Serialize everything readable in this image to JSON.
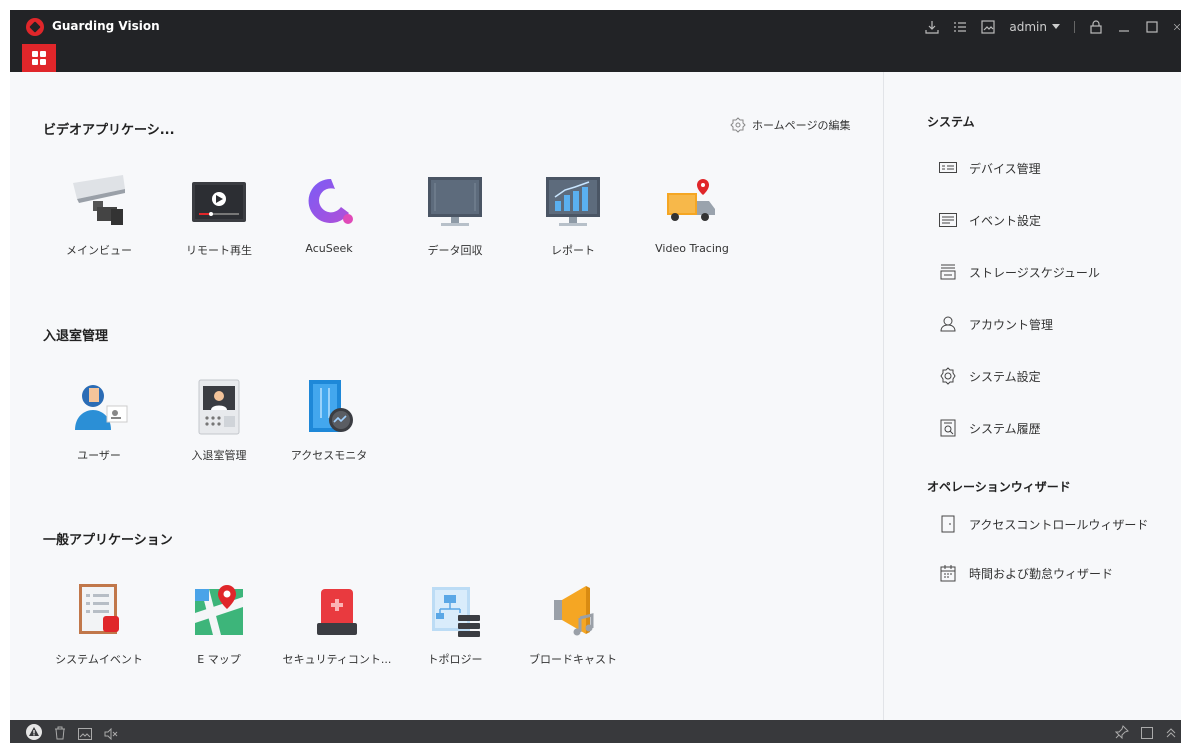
{
  "window": {
    "title": "Guarding Vision",
    "user": "admin"
  },
  "colors": {
    "brand_red": "#e0262a",
    "titlebar": "#222326",
    "content_bg": "#f7f8fa",
    "statusbar": "#38393c"
  },
  "main": {
    "edit_homepage_label": "ホームページの編集",
    "sections": [
      {
        "title": "ビデオアプリケーシ...",
        "items": [
          {
            "label": "メインビュー",
            "icon": "camera-icon"
          },
          {
            "label": "リモート再生",
            "icon": "playback-icon"
          },
          {
            "label": "AcuSeek",
            "icon": "acuseek-icon"
          },
          {
            "label": "データ回収",
            "icon": "data-monitor-icon"
          },
          {
            "label": "レポート",
            "icon": "report-chart-icon"
          },
          {
            "label": "Video Tracing",
            "icon": "truck-location-icon"
          }
        ]
      },
      {
        "title": "入退室管理",
        "items": [
          {
            "label": "ユーザー",
            "icon": "user-card-icon"
          },
          {
            "label": "入退室管理",
            "icon": "door-station-icon"
          },
          {
            "label": "アクセスモニタ",
            "icon": "access-monitor-icon"
          }
        ]
      },
      {
        "title": "一般アプリケーション",
        "items": [
          {
            "label": "システムイベント",
            "icon": "system-event-icon"
          },
          {
            "label": "E マップ",
            "icon": "map-pin-icon"
          },
          {
            "label": "セキュリティコント...",
            "icon": "alarm-light-icon"
          },
          {
            "label": "トポロジー",
            "icon": "topology-icon"
          },
          {
            "label": "ブロードキャスト",
            "icon": "broadcast-icon"
          }
        ]
      }
    ]
  },
  "right_panel": {
    "system_title": "システム",
    "system_items": [
      {
        "label": "デバイス管理",
        "icon": "device-icon"
      },
      {
        "label": "イベント設定",
        "icon": "event-settings-icon"
      },
      {
        "label": "ストレージスケジュール",
        "icon": "storage-icon"
      },
      {
        "label": "アカウント管理",
        "icon": "account-icon"
      },
      {
        "label": "システム設定",
        "icon": "gear-icon"
      },
      {
        "label": "システム履歴",
        "icon": "log-search-icon"
      }
    ],
    "wizard_title": "オペレーションウィザード",
    "wizard_items": [
      {
        "label": "アクセスコントロールウィザード",
        "icon": "door-icon"
      },
      {
        "label": "時間および勤怠ウィザード",
        "icon": "calendar-icon"
      }
    ]
  }
}
